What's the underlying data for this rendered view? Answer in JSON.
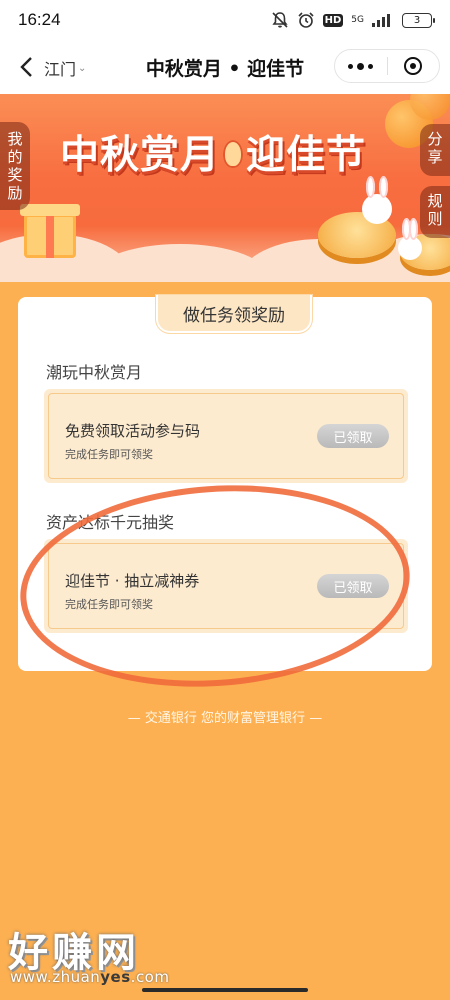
{
  "status": {
    "time": "16:24",
    "network": "5G",
    "hd": "HD",
    "battery": "3"
  },
  "nav": {
    "city": "江门",
    "title": "中秋赏月 • 迎佳节"
  },
  "banner": {
    "title_left": "中秋赏月",
    "title_right": "迎佳节",
    "left_tab": "我的奖励",
    "share_tab": "分享",
    "rules_tab": "规则"
  },
  "card": {
    "header": "做任务领奖励",
    "sections": [
      {
        "title": "潮玩中秋赏月",
        "task": {
          "name": "免费领取活动参与码",
          "desc": "完成任务即可领奖",
          "button": "已领取"
        }
      },
      {
        "title": "资产达标千元抽奖",
        "task": {
          "name": "迎佳节 · 抽立减神券",
          "desc": "完成任务即可领奖",
          "button": "已领取"
        }
      }
    ]
  },
  "footer": "— 交通银行 您的财富管理银行 —",
  "watermark": {
    "text": "好赚网",
    "url_prefix": "www.zhuan",
    "url_highlight": "yes",
    "url_suffix": ".com"
  },
  "colors": {
    "page_bg": "#fdb051",
    "banner": "#f76b3d",
    "task_bg": "#fdebd0",
    "circle": "#f16b3c"
  }
}
